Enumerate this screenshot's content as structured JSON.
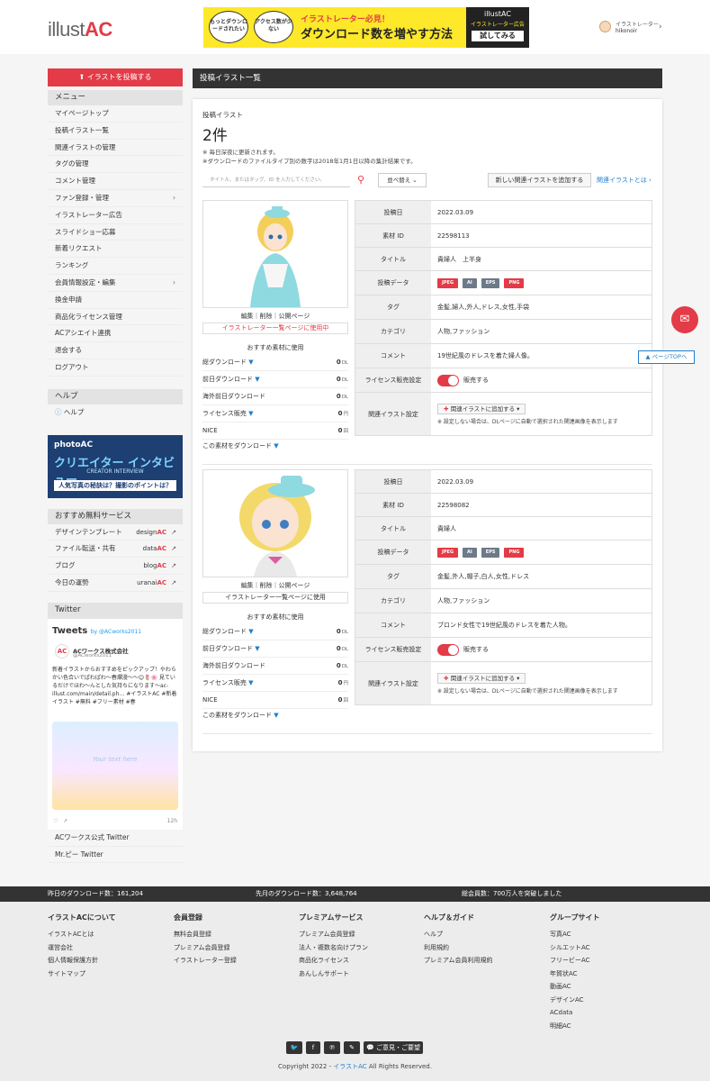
{
  "header": {
    "logo_text": "illust",
    "logo_accent": "AC",
    "banner": {
      "bubble1": "もっとダウンロードされたい",
      "bubble2": "アクセス数が少ない",
      "tagline": "イラストレーター必見！",
      "headline": "ダウンロード数を増やす方法",
      "right_logo": "illustAC",
      "right_sub": "イラストレーター広告",
      "right_cta": "試してみる"
    },
    "user": {
      "role": "イラストレーター",
      "name": "hikonoir"
    }
  },
  "sidebar": {
    "post_button": "イラストを投稿する",
    "menu_title": "メニュー",
    "menu_items": [
      {
        "label": "マイページトップ",
        "arrow": ""
      },
      {
        "label": "投稿イラスト一覧",
        "arrow": ""
      },
      {
        "label": "関連イラストの管理",
        "arrow": ""
      },
      {
        "label": "タグの管理",
        "arrow": ""
      },
      {
        "label": "コメント管理",
        "arrow": ""
      },
      {
        "label": "ファン登録・管理",
        "arrow": "›"
      },
      {
        "label": "イラストレーター広告",
        "arrow": ""
      },
      {
        "label": "スライドショー応募",
        "arrow": ""
      },
      {
        "label": "新着リクエスト",
        "arrow": ""
      },
      {
        "label": "ランキング",
        "arrow": ""
      },
      {
        "label": "会員情報設定・編集",
        "arrow": "›"
      },
      {
        "label": "換金申請",
        "arrow": ""
      },
      {
        "label": "商品化ライセンス管理",
        "arrow": ""
      },
      {
        "label": "ACアシエイト連携",
        "arrow": ""
      },
      {
        "label": "退会する",
        "arrow": ""
      },
      {
        "label": "ログアウト",
        "arrow": ""
      }
    ],
    "help_title": "ヘルプ",
    "help_item": "ヘルプ",
    "photoac_ad": {
      "logo": "photoAC",
      "title": "クリエイター インタビュー",
      "sub": "CREATOR INTERVIEW",
      "bar": "人気写真の秘訣は？撮影のポイントは？"
    },
    "services_title": "おすすめ無料サービス",
    "services": [
      {
        "label": "デザインテンプレート",
        "brand": "design",
        "brand_ac": "AC"
      },
      {
        "label": "ファイル転送・共有",
        "brand": "data",
        "brand_ac": "AC"
      },
      {
        "label": "ブログ",
        "brand": "blog",
        "brand_ac": "AC"
      },
      {
        "label": "今日の運勢",
        "brand": "uranai",
        "brand_ac": "AC"
      }
    ],
    "twitter_title": "Twitter",
    "tweets": {
      "header": "Tweets",
      "by": "by @ACworks2011",
      "account_name": "ACワークス株式会社",
      "account_handle": "@ACworks2011",
      "text": "新着イラストからおすすめをピックアップ！やわらかい色合いでぱわぱわ〜春爛漫〜〜😊🌷🌸 見ているだけでほわ〜んとした気持ちになります〜ac-illust.com/main/detail.ph… #イラストAC #新着イラスト #無料 #フリー素材 #春",
      "image_text": "Your text here",
      "time": "12h"
    },
    "twitter_links": [
      "ACワークス公式 Twitter",
      "Mr.ピー Twitter"
    ]
  },
  "main": {
    "heading": "投稿イラスト一覧",
    "label": "投稿イラスト",
    "count": "2件",
    "note1": "※ 毎日深夜に更新されます。",
    "note2": "※ダウンロードのファイルタイプ別の数字は2018年1月1日以降の集計結果です。",
    "search_placeholder": "タイトル、またはタッグ、ID を入力してください。",
    "sort_label": "並べ替え ⌄",
    "add_related": "新しい関連イラストを追加する",
    "related_link": "関連イラストとは ›",
    "actions": "編集｜削除｜公開ページ",
    "recommend_label": "おすすめ素材に使用",
    "download_link": "この素材をダウンロード",
    "stat_labels": [
      "総ダウンロード",
      "前日ダウンロード",
      "海外前日ダウンロード",
      "ライセンス販売",
      "NICE"
    ],
    "row_labels": [
      "投稿日",
      "素材 ID",
      "タイトル",
      "投稿データ",
      "タグ",
      "カテゴリ",
      "コメント",
      "ライセンス販売設定",
      "関連イラスト設定"
    ],
    "formats": [
      "JPEG",
      "AI",
      "EPS",
      "PNG"
    ],
    "sell_label": "販売する",
    "add_rel_btn": "関連イラストに追加する",
    "rel_note": "※ 設定しない場合は、DLページに自動で選択された関連画像を表示します",
    "items": [
      {
        "used_text": "イラストレーター一覧ページに使用中",
        "used_color": "#e33b47",
        "stats": [
          {
            "v": "0",
            "u": "DL"
          },
          {
            "v": "0",
            "u": "DL"
          },
          {
            "v": "0",
            "u": "DL"
          },
          {
            "v": "0",
            "u": "円"
          },
          {
            "v": "0",
            "u": "回"
          }
        ],
        "date": "2022.03.09",
        "id": "22598113",
        "title": "貴婦人　上半身",
        "tags": "金髪,婦人,外人,ドレス,女性,手袋",
        "category": "人物,ファッション",
        "comment": "19世紀風のドレスを着た婦人像。"
      },
      {
        "used_text": "イラストレーター一覧ページに使用",
        "used_color": "#333333",
        "stats": [
          {
            "v": "0",
            "u": "DL"
          },
          {
            "v": "0",
            "u": "DL"
          },
          {
            "v": "0",
            "u": "DL"
          },
          {
            "v": "0",
            "u": "円"
          },
          {
            "v": "0",
            "u": "回"
          }
        ],
        "date": "2022.03.09",
        "id": "22598082",
        "title": "貴婦人",
        "tags": "金髪,外人,帽子,白人,女性,ドレス",
        "category": "人物,ファッション",
        "comment": "ブロンド女性で19世紀風のドレスを着た人物。"
      }
    ]
  },
  "floating": {
    "page_top": "▲ ページTOPへ"
  },
  "stats_bar": {
    "yesterday": "昨日のダウンロード数：161,204",
    "last_month": "先月のダウンロード数：3,648,764",
    "members": "総会員数：700万人を突破しました"
  },
  "footer": {
    "cols": [
      {
        "title": "イラストACについて",
        "items": [
          "イラストACとは",
          "運営会社",
          "個人情報保護方針",
          "サイトマップ"
        ]
      },
      {
        "title": "会員登録",
        "items": [
          "無料会員登録",
          "プレミアム会員登録",
          "イラストレーター登録"
        ]
      },
      {
        "title": "プレミアムサービス",
        "items": [
          "プレミアム会員登録",
          "法人・複数名向けプラン",
          "商品化ライセンス",
          "あんしんサポート"
        ]
      },
      {
        "title": "ヘルプ＆ガイド",
        "items": [
          "ヘルプ",
          "利用規約",
          "プレミアム会員利用規約"
        ]
      },
      {
        "title": "グループサイト",
        "items": [
          "写真AC",
          "シルエットAC",
          "フリービーAC",
          "年賀状AC",
          "動画AC",
          "デザインAC",
          "ACdata",
          "明細AC"
        ]
      }
    ],
    "social_feedback": "ご意見・ご要望",
    "copyright": "Copyright 2022 - ",
    "copyright_link": "イラストAC",
    "copyright_tail": "  All Rights Reserved."
  }
}
